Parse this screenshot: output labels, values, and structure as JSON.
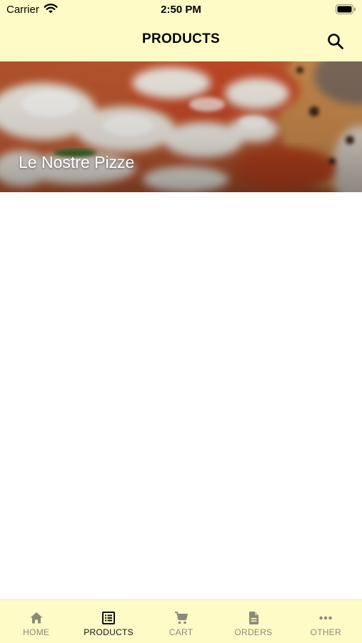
{
  "status_bar": {
    "carrier": "Carrier",
    "time": "2:50 PM"
  },
  "header": {
    "title": "PRODUCTS",
    "search_icon": "search-icon"
  },
  "categories": [
    {
      "title": "Le Nostre Pizze",
      "image": "pizza-margherita-photo"
    }
  ],
  "tab_bar": {
    "active": "PRODUCTS",
    "active_color": "#111111",
    "inactive_color": "#8b8a78",
    "background": "#fefbc7",
    "items": [
      {
        "label": "HOME",
        "icon": "home-icon"
      },
      {
        "label": "PRODUCTS",
        "icon": "list-icon"
      },
      {
        "label": "CART",
        "icon": "cart-icon"
      },
      {
        "label": "ORDERS",
        "icon": "document-icon"
      },
      {
        "label": "OTHER",
        "icon": "more-icon"
      }
    ]
  }
}
